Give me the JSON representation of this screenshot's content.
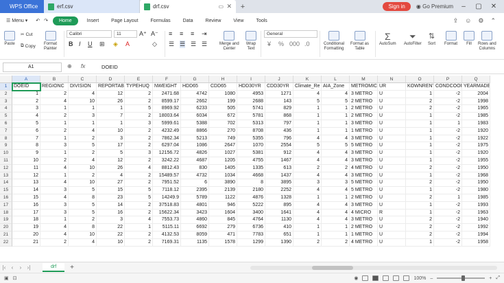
{
  "titlebar": {
    "app_tab": "WPS Office",
    "tabs": [
      {
        "label": "erf.csv"
      },
      {
        "label": "drf.csv"
      }
    ],
    "signin": "Sign in",
    "premium": "Go Premium"
  },
  "ribbon_tabs": {
    "menu": "Menu",
    "items": [
      "Home",
      "Insert",
      "Page Layout",
      "Formulas",
      "Data",
      "Review",
      "View",
      "Tools"
    ]
  },
  "ribbon": {
    "paste": "Paste",
    "cut": "Cut",
    "copy": "Copy",
    "format_painter_1": "Format",
    "format_painter_2": "Painter",
    "font_name": "Calibri",
    "font_size": "11",
    "merge_1": "Merge and",
    "merge_2": "Center",
    "wrap_1": "Wrap",
    "wrap_2": "Text",
    "number_format": "General",
    "cond_1": "Conditional",
    "cond_2": "Formatting",
    "table_1": "Format as",
    "table_2": "Table",
    "autosum": "AutoSum",
    "autofilter": "AutoFilter",
    "sort": "Sort",
    "format": "Format",
    "fill": "Fill",
    "rowscols_1": "Rows and",
    "rowscols_2": "Columns"
  },
  "formula_bar": {
    "cell_ref": "A1",
    "content": "DOEID"
  },
  "sheet": {
    "columns": [
      "A",
      "B",
      "C",
      "D",
      "E",
      "F",
      "G",
      "H",
      "I",
      "J",
      "K",
      "L",
      "M",
      "N",
      "O",
      "P",
      "Q"
    ],
    "header_row": [
      "DOEID",
      "REGIONC",
      "DIVISION",
      "REPORTABL",
      "TYPEHUQ",
      "NWEIGHT",
      "HDD65",
      "CDD65",
      "HDD30YR",
      "CDD30YR",
      "Climate_Re",
      "AIA_Zone",
      "METROMIC",
      "UR",
      "KOWNRENT",
      "CONDCOOF",
      "YEARMADE"
    ],
    "rows": [
      [
        "1",
        "2",
        "4",
        "12",
        "2",
        "2471.68",
        "4742",
        "1080",
        "4953",
        "1271",
        "4",
        "4",
        "3 METRO",
        "U",
        "1",
        "-2",
        "2004"
      ],
      [
        "2",
        "4",
        "10",
        "26",
        "2",
        "8599.17",
        "2662",
        "199",
        "2688",
        "143",
        "5",
        "5",
        "2 METRO",
        "U",
        "2",
        "-2",
        "1998"
      ],
      [
        "3",
        "1",
        "1",
        "1",
        "5",
        "8969.92",
        "6233",
        "505",
        "5741",
        "829",
        "1",
        "1",
        "2 METRO",
        "U",
        "2",
        "-2",
        "1965"
      ],
      [
        "4",
        "2",
        "3",
        "7",
        "2",
        "18003.64",
        "6034",
        "672",
        "5781",
        "868",
        "1",
        "1",
        "2 METRO",
        "U",
        "1",
        "-2",
        "1985"
      ],
      [
        "5",
        "1",
        "1",
        "1",
        "3",
        "5999.61",
        "5388",
        "702",
        "5313",
        "797",
        "1",
        "1",
        "3 METRO",
        "U",
        "1",
        "1",
        "1983"
      ],
      [
        "6",
        "2",
        "4",
        "10",
        "2",
        "4232.49",
        "8866",
        "270",
        "8708",
        "436",
        "1",
        "1",
        "1 METRO",
        "U",
        "1",
        "-2",
        "1920"
      ],
      [
        "7",
        "1",
        "2",
        "3",
        "2",
        "7862.34",
        "5213",
        "749",
        "5355",
        "796",
        "4",
        "4",
        "3 METRO",
        "U",
        "1",
        "-2",
        "1922"
      ],
      [
        "8",
        "3",
        "5",
        "17",
        "2",
        "6297.04",
        "1086",
        "2647",
        "1070",
        "2554",
        "5",
        "5",
        "5 METRO",
        "U",
        "1",
        "-2",
        "1975"
      ],
      [
        "9",
        "1",
        "2",
        "5",
        "3",
        "12156.72",
        "4826",
        "1027",
        "5381",
        "912",
        "4",
        "4",
        "3 METRO",
        "U",
        "1",
        "-2",
        "1920"
      ],
      [
        "10",
        "2",
        "4",
        "12",
        "2",
        "3242.22",
        "4687",
        "1205",
        "4755",
        "1467",
        "4",
        "4",
        "3 METRO",
        "U",
        "1",
        "-2",
        "1955"
      ],
      [
        "11",
        "4",
        "10",
        "26",
        "4",
        "8812.43",
        "830",
        "1405",
        "1335",
        "613",
        "2",
        "2",
        "4 METRO",
        "U",
        "2",
        "-2",
        "1950"
      ],
      [
        "12",
        "1",
        "2",
        "4",
        "2",
        "15489.57",
        "4732",
        "1034",
        "4668",
        "1437",
        "4",
        "4",
        "3 METRO",
        "U",
        "1",
        "-2",
        "1968"
      ],
      [
        "13",
        "4",
        "10",
        "27",
        "2",
        "7951.52",
        "6",
        "3890",
        "8",
        "3895",
        "3",
        "3",
        "5 METRO",
        "U",
        "2",
        "-2",
        "1950"
      ],
      [
        "14",
        "3",
        "5",
        "15",
        "5",
        "7118.12",
        "2395",
        "2139",
        "2180",
        "2252",
        "4",
        "4",
        "5 METRO",
        "U",
        "1",
        "-2",
        "1980"
      ],
      [
        "15",
        "4",
        "8",
        "23",
        "5",
        "14249.9",
        "5789",
        "1122",
        "4876",
        "1328",
        "1",
        "1",
        "2 METRO",
        "U",
        "2",
        "1",
        "1985"
      ],
      [
        "16",
        "3",
        "5",
        "14",
        "2",
        "37518.83",
        "4801",
        "946",
        "5222",
        "895",
        "4",
        "4",
        "3 METRO",
        "U",
        "1",
        "-2",
        "1993"
      ],
      [
        "17",
        "3",
        "5",
        "16",
        "2",
        "15622.34",
        "3423",
        "1604",
        "3400",
        "1641",
        "4",
        "4",
        "4 MICRO",
        "R",
        "1",
        "-2",
        "1963"
      ],
      [
        "18",
        "1",
        "2",
        "3",
        "4",
        "7553.73",
        "4860",
        "845",
        "4764",
        "1130",
        "4",
        "4",
        "3 METRO",
        "U",
        "2",
        "-2",
        "1940"
      ],
      [
        "19",
        "4",
        "8",
        "22",
        "1",
        "5115.11",
        "6692",
        "279",
        "6736",
        "410",
        "1",
        "1",
        "2 METRO",
        "U",
        "2",
        "-2",
        "1992"
      ],
      [
        "20",
        "4",
        "10",
        "22",
        "2",
        "4132.53",
        "8059",
        "471",
        "7783",
        "651",
        "1",
        "1",
        "1 METRO",
        "U",
        "2",
        "-2",
        "1994"
      ],
      [
        "21",
        "2",
        "4",
        "10",
        "2",
        "7169.31",
        "1135",
        "1578",
        "1299",
        "1390",
        "2",
        "2",
        "4 METRO",
        "U",
        "1",
        "-2",
        "1958"
      ]
    ]
  },
  "sheet_tab": "drf",
  "status": {
    "zoom": "100%"
  }
}
